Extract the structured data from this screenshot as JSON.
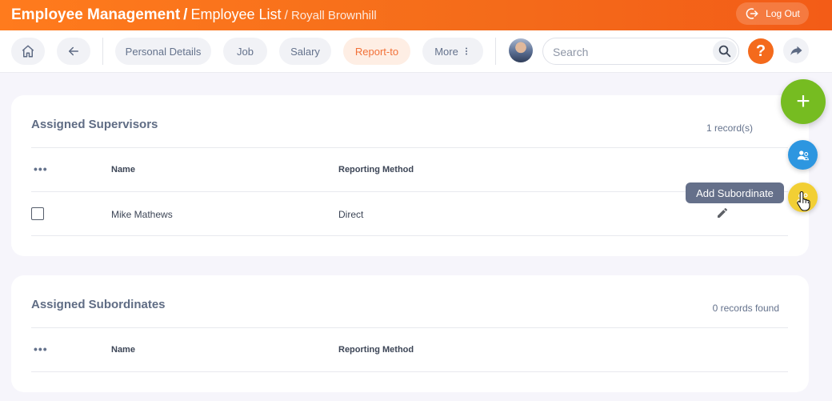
{
  "header": {
    "module": "Employee Management",
    "separator": "/",
    "page": "Employee List",
    "employee": "Royall Brownhill",
    "logout_label": "Log Out"
  },
  "toolbar": {
    "tabs": [
      {
        "label": "Personal Details"
      },
      {
        "label": "Job"
      },
      {
        "label": "Salary"
      },
      {
        "label": "Report-to"
      },
      {
        "label": "More"
      }
    ],
    "search_placeholder": "Search",
    "help_label": "?"
  },
  "supervisors": {
    "title": "Assigned Supervisors",
    "count": "1 record(s)",
    "columns": {
      "actions": "•••",
      "name": "Name",
      "method": "Reporting Method"
    },
    "rows": [
      {
        "name": "Mike Mathews",
        "method": "Direct"
      }
    ]
  },
  "subordinates": {
    "title": "Assigned Subordinates",
    "count": "0 records found",
    "columns": {
      "actions": "•••",
      "name": "Name",
      "method": "Reporting Method"
    }
  },
  "fab": {
    "main_label": "+",
    "tooltip": "Add Subordinate"
  },
  "colors": {
    "accent": "#f46a1c",
    "fab_main": "#76bc21",
    "fab_blue": "#2d96e0",
    "fab_yellow": "#f2cf34",
    "tooltip_bg": "#65708a"
  },
  "icons": [
    "home-icon",
    "back-arrow-icon",
    "kebab-icon",
    "search-icon",
    "help-icon",
    "share-icon",
    "logout-icon",
    "edit-icon",
    "add-supervisor-icon",
    "add-subordinate-icon",
    "pointer-cursor-icon"
  ]
}
